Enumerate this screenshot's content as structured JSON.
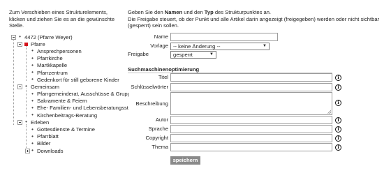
{
  "left": {
    "intro": "Zum Verschieben eines Strukturelements, klicken und ziehen Sie es an die gewünschte Stelle."
  },
  "tree": {
    "root": "4472 (Pfarre Weyer)",
    "pfarre": "Pfarre",
    "pfarre_children": [
      "Ansprechpersonen",
      "Pfarrkirche",
      "Martkkapelle",
      "Pfarrzentrum",
      "Gedenkort für still geborene Kinder"
    ],
    "gemeinsam": "Gemeinsam",
    "gemeinsam_children": [
      "Pfarrgemeinderat, Ausschüsse & Gruppen",
      "Sakramente & Feiern",
      "Ehe- Familien- und Lebensberatungsstellen",
      "Kirchenbeitrags-Beratung"
    ],
    "erleben": "Erleben",
    "erleben_children": [
      "Gottesdienste & Termine",
      "Pfarrblatt",
      "Bilder",
      "Downloads"
    ]
  },
  "form": {
    "intro_prefix": "Geben Sie den ",
    "intro_name": "Namen",
    "intro_middle": " und den ",
    "intro_typ": "Typ",
    "intro_suffix": " des Strukturpunktes an.",
    "intro_line2": "Die Freigabe steuert, ob der Punkt und alle Artikel darin angezeigt (freigegeben) werden oder nicht sichtbar (gesperrt) sein sollen.",
    "name_label": "Name",
    "name_value": "",
    "vorlage_label": "Vorlage",
    "vorlage_value": "-- keine Änderung --",
    "freigabe_label": "Freigabe",
    "freigabe_value": "gesperrt",
    "seo_title": "Suchmaschinenoptimierung",
    "titel_label": "Titel",
    "schluesselwoerter_label": "Schlüsselwörter",
    "beschreibung_label": "Beschreibung",
    "autor_label": "Autor",
    "sprache_label": "Sprache",
    "copyright_label": "Copyright",
    "thema_label": "Thema",
    "info_glyph": "i",
    "save_label": "speichern"
  }
}
